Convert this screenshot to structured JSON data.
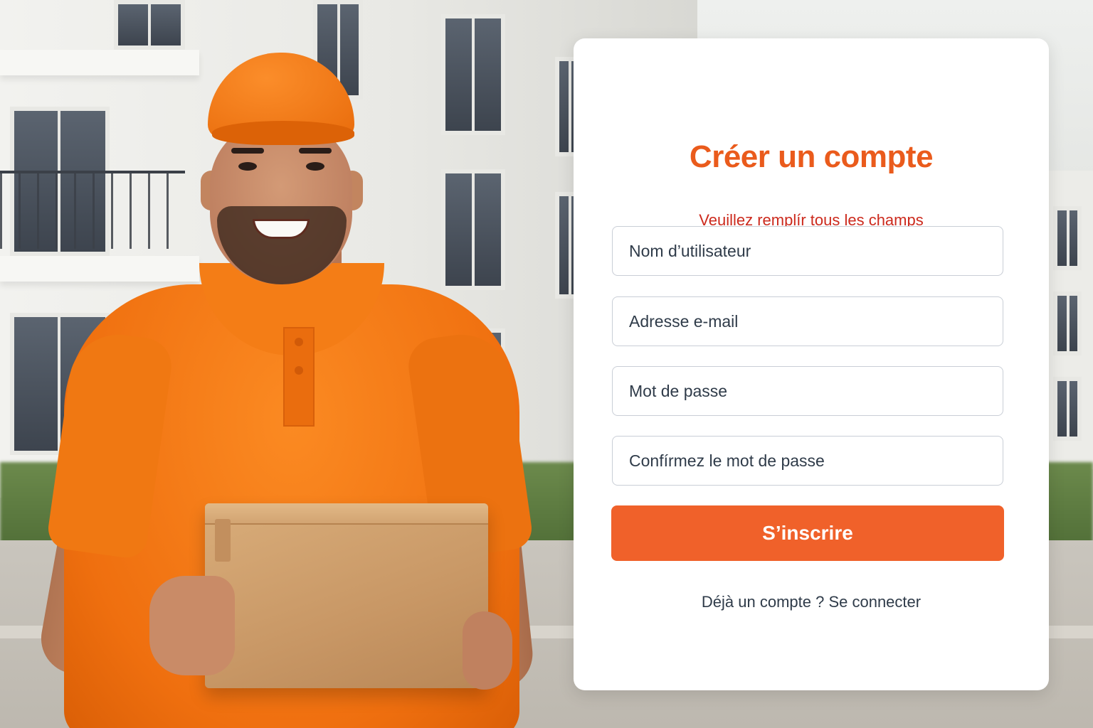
{
  "form": {
    "title": "Créer un compte",
    "subtitle": "Veuillez remplír tous les champs",
    "fields": [
      {
        "placeholder": "Nom d’utilisateur"
      },
      {
        "placeholder": "Adresse e-mail"
      },
      {
        "placeholder": "Mot de passe"
      },
      {
        "placeholder": "Confírmez le mot de passe"
      }
    ],
    "submit_label": "S’inscrire",
    "login_prompt": "Déjà un compte ?",
    "login_link": "Se connecter"
  },
  "colors": {
    "accent": "#f0612a",
    "title": "#ea5b1c",
    "subtitle": "#cc2a1d",
    "text": "#2f3b49"
  },
  "illustration": {
    "description_icons": [
      "delivery-person-photo",
      "cardboard-box",
      "apartment-building"
    ]
  }
}
